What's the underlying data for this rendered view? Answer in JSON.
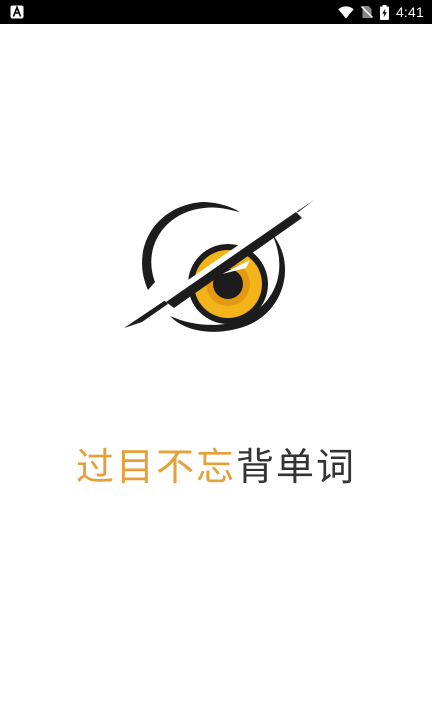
{
  "status_bar": {
    "time": "4:41",
    "icons": [
      "notification-a-icon",
      "wifi-icon",
      "no-sim-icon",
      "battery-charging-icon"
    ],
    "background": "#000000"
  },
  "splash": {
    "logo_icon": "owl-eye-logo",
    "title_accent": "过目不忘",
    "title_main": "背单词",
    "accent_color": "#e6a03a",
    "main_color": "#333333",
    "eye_colors": [
      "#f2b418",
      "#1a1a1a"
    ]
  }
}
